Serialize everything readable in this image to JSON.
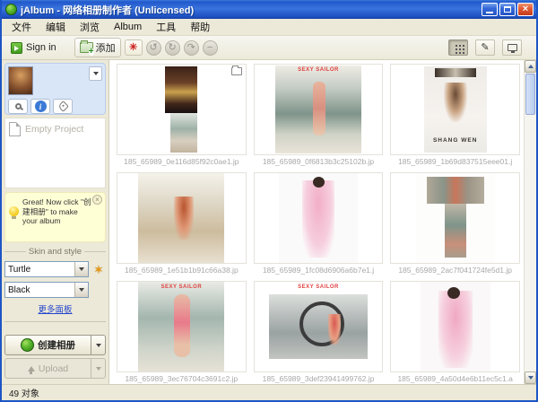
{
  "window": {
    "title": "jAlbum - 网络相册制作者 (Unlicensed)"
  },
  "menu": {
    "items": [
      "文件",
      "编辑",
      "浏览",
      "Album",
      "工具",
      "帮助"
    ]
  },
  "toolbar": {
    "sign_in_label": "Sign in",
    "add_label": "添加"
  },
  "sidebar": {
    "empty_project_label": "Empty Project",
    "tip_text": "Great! Now click \"创建相册\" to make your album",
    "skin_section_label": "Skin and style",
    "skin_selected": "Turtle",
    "style_selected": "Black",
    "more_skins_link": "更多面板",
    "create_album_label": "创建相册",
    "upload_label": "Upload"
  },
  "status": {
    "object_count": "49 对象"
  },
  "colors": {
    "titlebar_blue": "#2258cc",
    "close_red": "#e25a33",
    "accent_green": "#56b52c",
    "tip_yellow": "#ffffd6"
  },
  "grid": {
    "items": [
      {
        "filename": "185_65989_0e116d85f92c0ae1.jp",
        "look": "folder-stack",
        "overlay": "",
        "is_folder": true
      },
      {
        "filename": "185_65989_0f6813b3c25102b.jp",
        "look": "boat-portrait",
        "overlay": "SEXY SAILOR",
        "is_folder": false
      },
      {
        "filename": "185_65989_1b69d837515eee01.j",
        "look": "white-bed",
        "overlay": "SHANG WEN",
        "is_folder": false
      },
      {
        "filename": "185_65989_1e51b1b91c66a38.jp",
        "look": "boat-girl",
        "overlay": "",
        "is_folder": false
      },
      {
        "filename": "185_65989_1fc08d6906a6b7e1.j",
        "look": "pink-sailor",
        "overlay": "",
        "is_folder": false
      },
      {
        "filename": "185_65989_2ac7f041724fe5d1.jp",
        "look": "collage-t",
        "overlay": "",
        "is_folder": false
      },
      {
        "filename": "185_65989_3ec76704c3691c2.jp",
        "look": "boat-back",
        "overlay": "SEXY SAILOR",
        "is_folder": false
      },
      {
        "filename": "185_65989_3def23941499762.jp",
        "look": "ship-wheel",
        "overlay": "SEXY SAILOR",
        "is_folder": false
      },
      {
        "filename": "185_65989_4a50d4e6b11ec5c1.a",
        "look": "pink-salute",
        "overlay": "",
        "is_folder": false
      }
    ]
  }
}
